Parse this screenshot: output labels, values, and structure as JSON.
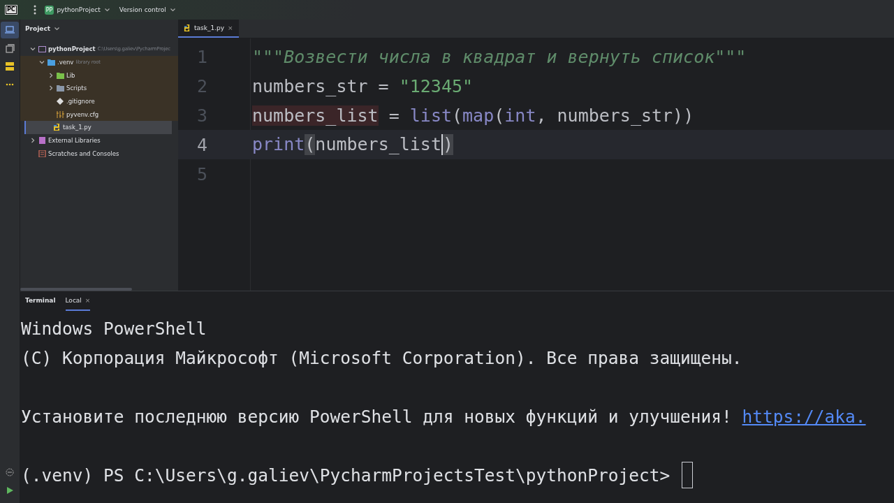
{
  "toolbar": {
    "app_badge": "PC",
    "project_badge": "PP",
    "project": "pythonProject",
    "vcs": "Version control"
  },
  "project_panel": {
    "title": "Project",
    "tree": [
      {
        "kind": "project",
        "label": "pythonProject",
        "hint": "C:\\Users\\g.galiev\\PycharmProjec",
        "expanded": true,
        "selected": false,
        "children": [
          {
            "kind": "venv",
            "label": ".venv",
            "hint": "library root",
            "expanded": true,
            "selected": false,
            "children": [
              {
                "kind": "lib",
                "label": "Lib",
                "expanded": false,
                "selected": false
              },
              {
                "kind": "scripts",
                "label": "Scripts",
                "expanded": false,
                "selected": false
              },
              {
                "kind": "gitignore",
                "label": ".gitignore",
                "selected": false
              },
              {
                "kind": "cfg",
                "label": "pyvenv.cfg",
                "selected": false
              }
            ]
          },
          {
            "kind": "python",
            "label": "task_1.py",
            "selected": true
          }
        ]
      },
      {
        "kind": "libraries",
        "label": "External Libraries",
        "expanded": false,
        "selected": false
      },
      {
        "kind": "scratches",
        "label": "Scratches and Consoles",
        "selected": false
      }
    ]
  },
  "editor": {
    "tabs": [
      {
        "label": "task_1.py",
        "close": "×",
        "selected": true
      }
    ],
    "lines": [
      {
        "number": "1",
        "current": false,
        "tokens": [
          {
            "kind": "doc",
            "text": "\"\"\"Возвести числа в квадрат и вернуть список\"\"\""
          }
        ]
      },
      {
        "number": "2",
        "current": false,
        "tokens": [
          {
            "kind": "plain",
            "text": "numbers_str = "
          },
          {
            "kind": "string",
            "text": "\"12345\""
          }
        ]
      },
      {
        "number": "3",
        "current": false,
        "tokens": [
          {
            "kind": "marked",
            "text": "numbers_list"
          },
          {
            "kind": "plain",
            "text": " = "
          },
          {
            "kind": "builtin",
            "text": "list"
          },
          {
            "kind": "paren",
            "text": "("
          },
          {
            "kind": "builtin",
            "text": "map"
          },
          {
            "kind": "paren",
            "text": "("
          },
          {
            "kind": "builtin",
            "text": "int"
          },
          {
            "kind": "plain",
            "text": ", numbers_str"
          },
          {
            "kind": "paren",
            "text": "))"
          }
        ]
      },
      {
        "number": "4",
        "current": true,
        "tokens": [
          {
            "kind": "builtin",
            "text": "print"
          },
          {
            "kind": "match",
            "text": "("
          },
          {
            "kind": "plain",
            "text": "numbers_list"
          },
          {
            "kind": "caret"
          },
          {
            "kind": "match",
            "text": ")"
          }
        ]
      },
      {
        "number": "5",
        "current": false
      }
    ]
  },
  "terminal": {
    "tabs": [
      {
        "label": "Terminal",
        "selected": false
      },
      {
        "label": "Local",
        "close": "×",
        "selected": true
      }
    ],
    "lines": [
      {
        "kind": "text",
        "text": "Windows PowerShell"
      },
      {
        "kind": "text",
        "text": "(C) Корпорация Майкрософт (Microsoft Corporation). Все права защищены."
      },
      {
        "kind": "blank"
      },
      {
        "kind": "link",
        "text": "Установите последнюю версию PowerShell для новых функций и улучшения! ",
        "link": "https://aka."
      },
      {
        "kind": "blank"
      },
      {
        "kind": "prompt",
        "text": "(.venv) PS C:\\Users\\g.galiev\\PycharmProjectsTest\\pythonProject> "
      }
    ]
  }
}
